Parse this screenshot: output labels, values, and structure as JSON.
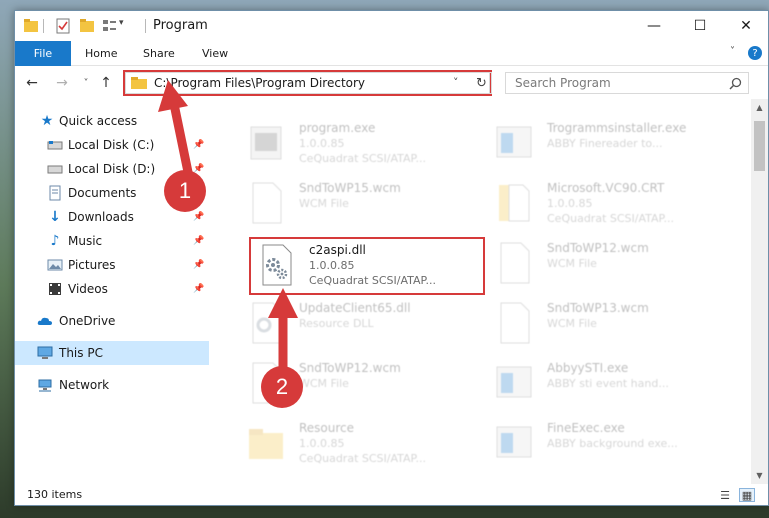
{
  "window": {
    "title": "Program",
    "controls": {
      "minimize": "—",
      "maximize": "☐",
      "close": "✕"
    }
  },
  "ribbon": {
    "tabs": [
      "File",
      "Home",
      "Share",
      "View"
    ],
    "expand_icon": "chevron-down-icon",
    "help_icon": "help-icon"
  },
  "navigation": {
    "back": "←",
    "forward": "→",
    "recent": "˅",
    "up": "↑"
  },
  "address": {
    "path": "C:\\Program Files\\Program Directory",
    "dropdown": "˅",
    "refresh": "↻"
  },
  "search": {
    "placeholder": "Search Program",
    "icon": "search-icon"
  },
  "sidebar": {
    "items": [
      {
        "label": "Quick access",
        "icon": "star-icon",
        "pinned": false
      },
      {
        "label": "Local Disk (C:)",
        "icon": "drive-icon",
        "pinned": true
      },
      {
        "label": "Local Disk (D:)",
        "icon": "drive-icon",
        "pinned": true
      },
      {
        "label": "Documents",
        "icon": "documents-icon",
        "pinned": true
      },
      {
        "label": "Downloads",
        "icon": "download-icon",
        "pinned": true
      },
      {
        "label": "Music",
        "icon": "music-icon",
        "pinned": true
      },
      {
        "label": "Pictures",
        "icon": "pictures-icon",
        "pinned": true
      },
      {
        "label": "Videos",
        "icon": "videos-icon",
        "pinned": true
      },
      {
        "label": "OneDrive",
        "icon": "cloud-icon",
        "pinned": false
      },
      {
        "label": "This PC",
        "icon": "computer-icon",
        "pinned": false,
        "selected": true
      },
      {
        "label": "Network",
        "icon": "network-icon",
        "pinned": false
      }
    ]
  },
  "files": {
    "left": [
      {
        "name": "program.exe",
        "line1": "1.0.0.85",
        "line2": "CeQuadrat SCSI/ATAP..."
      },
      {
        "name": "SndToWP15.wcm",
        "line1": "WCM File"
      },
      {
        "name": "c2aspi.dll",
        "line1": "1.0.0.85",
        "line2": "CeQuadrat SCSI/ATAP...",
        "highlighted": true
      },
      {
        "name": "UpdateClient65.dll",
        "line1": "Resource DLL"
      },
      {
        "name": "SndToWP12.wcm",
        "line1": "WCM File"
      },
      {
        "name": "Resource",
        "line1": "1.0.0.85",
        "line2": "CeQuadrat SCSI/ATAP..."
      }
    ],
    "right": [
      {
        "name": "Trogrammsinstaller.exe",
        "line1": "ABBY Finereader to..."
      },
      {
        "name": "Microsoft.VC90.CRT",
        "line1": "1.0.0.85",
        "line2": "CeQuadrat SCSI/ATAP..."
      },
      {
        "name": "SndToWP12.wcm",
        "line1": "WCM File"
      },
      {
        "name": "SndToWP13.wcm",
        "line1": "WCM File"
      },
      {
        "name": "AbbyySTI.exe",
        "line1": "ABBY sti event hand..."
      },
      {
        "name": "FineExec.exe",
        "line1": "ABBY background exe..."
      }
    ]
  },
  "status": {
    "item_count": "130 items"
  },
  "annotations": {
    "step1": "1",
    "step2": "2",
    "color": "#d63a3a"
  },
  "colors": {
    "accent": "#1979ca",
    "selected": "#cce8ff",
    "highlight": "#d63a3a"
  }
}
